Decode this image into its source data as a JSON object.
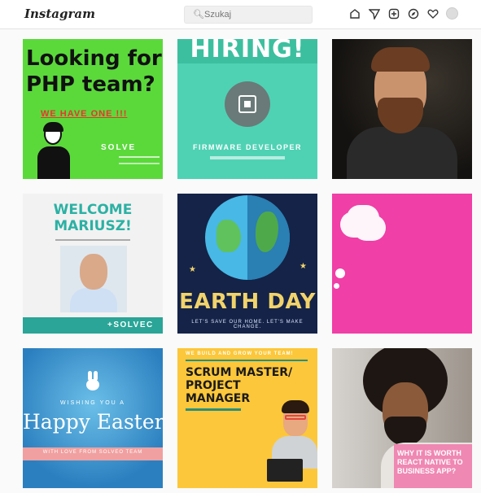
{
  "header": {
    "logo": "Instagram",
    "search_placeholder": "Szukaj",
    "icons": [
      "home-icon",
      "direct-icon",
      "new-post-icon",
      "explore-icon",
      "activity-icon",
      "profile-avatar"
    ]
  },
  "posts": [
    {
      "heading_line1": "Looking for",
      "heading_line2": "PHP team?",
      "subheading": "WE HAVE ONE !!!",
      "brand": "SOLVE",
      "colors": {
        "bg": "#5bd93b",
        "accent": "#e8362d"
      }
    },
    {
      "heading": "HIRING!",
      "caption": "FIRMWARE DEVELOPER",
      "colors": {
        "bg": "#4fd2b4"
      }
    },
    {
      "alt": "portrait of bearded man",
      "colors": {
        "bg": "#1f1d1a"
      }
    },
    {
      "heading_line1": "WELCOME",
      "heading_line2": "MARIUSZ!",
      "brand": "+SOLVEC",
      "colors": {
        "bg": "#f2f2f2",
        "accent": "#2cb1a4"
      }
    },
    {
      "heading": "EARTH DAY",
      "caption": "LET'S SAVE OUR HOME. LET'S MAKE CHANGE.",
      "colors": {
        "bg": "#142347",
        "accent": "#f1d36b"
      }
    },
    {
      "alt": "pink background with speech clouds",
      "colors": {
        "bg": "#f03fa6"
      }
    },
    {
      "wishing": "WISHING YOU A",
      "heading": "Happy Easter!",
      "strip": "WITH LOVE FROM SOLVEO TEAM",
      "colors": {
        "bg": "#3c9ad8"
      }
    },
    {
      "top_text": "WE BUILD AND GROW YOUR TEAM!",
      "heading_line1": "SCRUM MASTER/",
      "heading_line2": "PROJECT",
      "heading_line3": "MANAGER",
      "colors": {
        "bg": "#fcc73a"
      }
    },
    {
      "text_line1": "WHY IT IS WORTH",
      "text_line2": "REACT NATIVE TO",
      "text_line3": "BUSINESS APP?",
      "colors": {
        "bg": "#b9b4ad",
        "accent": "#f078aa"
      }
    }
  ]
}
